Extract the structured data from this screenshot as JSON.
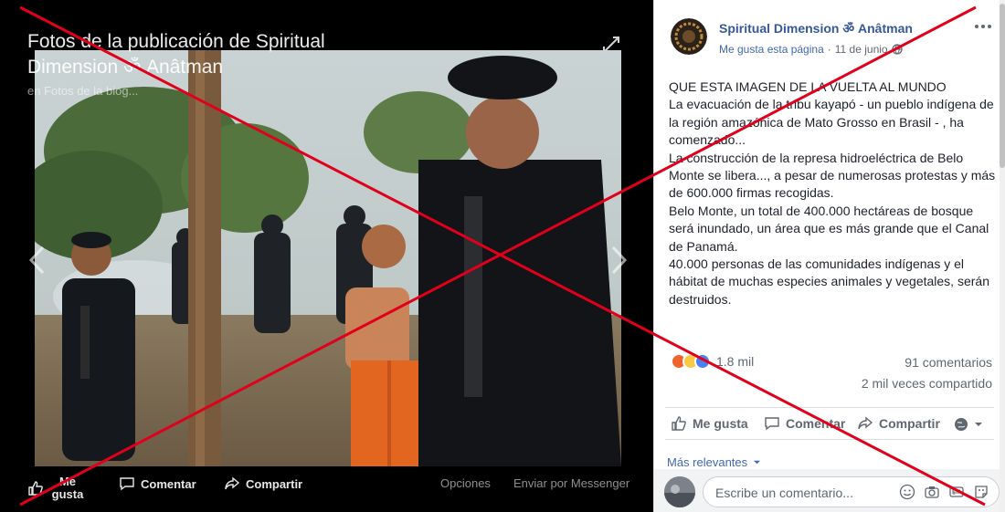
{
  "viewer": {
    "title": "Fotos de la publicación de Spiritual Dimension ॐ Anâtman",
    "subtitle": "en Fotos de la biog...",
    "like_label": "Me gusta",
    "comment_label": "Comentar",
    "share_label": "Compartir",
    "options_label": "Opciones",
    "messenger_label": "Enviar por Messenger"
  },
  "post": {
    "page_name": "Spiritual Dimension ॐ Anâtman",
    "like_page": "Me gusta esta página",
    "separator": "·",
    "date": "11 de junio",
    "paragraphs": [
      "QUE ESTA IMAGEN DE LA VUELTA AL MUNDO",
      "La evacuación de la tribu kayapó - un pueblo indígena de la región amazónica de Mato Grosso en Brasil - , ha comenzado...",
      "La construcción de la represa hidroeléctrica de Belo Monte se libera..., a pesar de numerosas protestas y más de 600.000 firmas recogidas.",
      "Belo Monte, un total de 400.000 hectáreas de bosque será inundado, un área que es más grande que el Canal de Panamá.",
      "40.000 personas de las comunidades indígenas y el hábitat de muchas especies animales y vegetales, serán destruidos."
    ],
    "reactions_count": "1.8 mil",
    "comments_count": "91 comentarios",
    "shares_count": "2 mil veces compartido",
    "action_like": "Me gusta",
    "action_comment": "Comentar",
    "action_share": "Compartir",
    "sort_label": "Más relevantes",
    "comment_placeholder": "Escribe un comentario..."
  },
  "icons": {
    "expand": "expand-icon",
    "prev": "chevron-left-icon",
    "next": "chevron-right-icon",
    "more": "more-icon",
    "globe": "globe-icon"
  },
  "colors": {
    "link": "#365899",
    "accent": "#4267b2",
    "x_overlay": "#e0001b"
  }
}
